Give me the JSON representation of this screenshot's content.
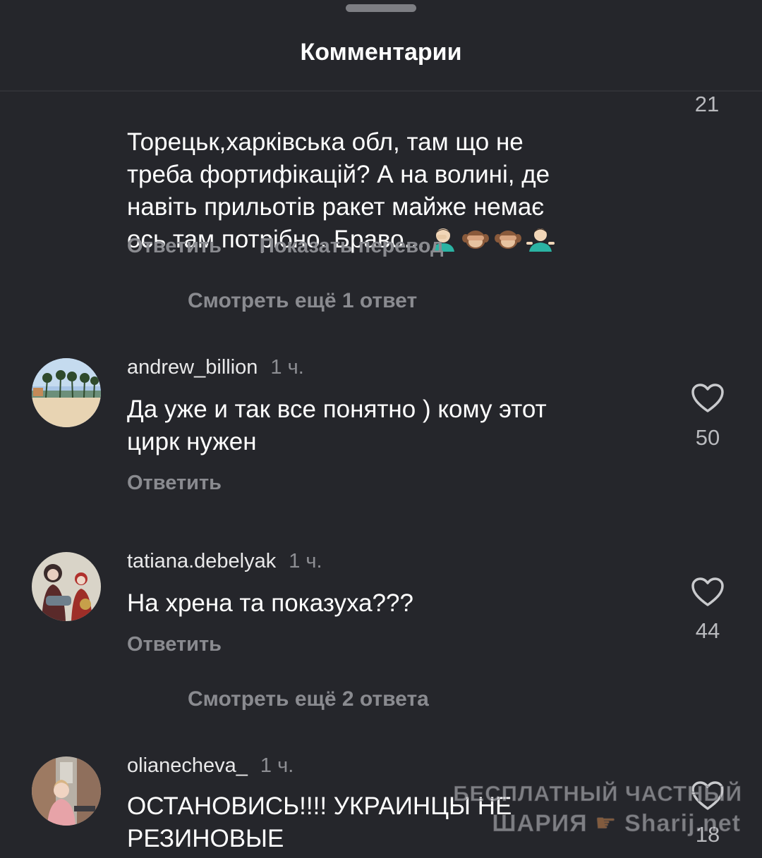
{
  "header": {
    "title": "Комментарии"
  },
  "comments": [
    {
      "text": "Торецьк,харківська обл, там що не\nтреба фортифікацій? А на волині, де\nнавіть прильотів ракет майже немає\nось там потрібно. Браво...",
      "emojis": [
        "facepalm-emoji",
        "see-no-evil-monkey-emoji",
        "see-no-evil-monkey-emoji",
        "shrug-emoji"
      ],
      "likes": "21",
      "reply_label": "Ответить",
      "translate_label": "Показать перевод",
      "more_replies": "Смотреть ещё 1 ответ"
    },
    {
      "username": "andrew_billion",
      "time": "1 ч.",
      "text": "Да уже и так все понятно ) кому этот\nцирк нужен",
      "likes": "50",
      "reply_label": "Ответить"
    },
    {
      "username": "tatiana.debelyak",
      "time": "1 ч.",
      "text": "На хрена та показуха???",
      "likes": "44",
      "reply_label": "Ответить",
      "more_replies": "Смотреть ещё 2 ответа"
    },
    {
      "username": "olianecheva_",
      "time": "1 ч.",
      "text": "ОСТАНОВИСЬ!!!! УКРАИНЦЫ НЕ\nРЕЗИНОВЫЕ",
      "likes": "18"
    }
  ],
  "watermark": {
    "line1": "БЕСПЛАТНЫЙ ЧАСТНЫЙ",
    "line2": "ШАРИЯ",
    "line3": "Sharij.net"
  },
  "colors": {
    "background": "#25262b",
    "secondary_text": "#8a8b90",
    "primary_text": "#ffffff"
  }
}
